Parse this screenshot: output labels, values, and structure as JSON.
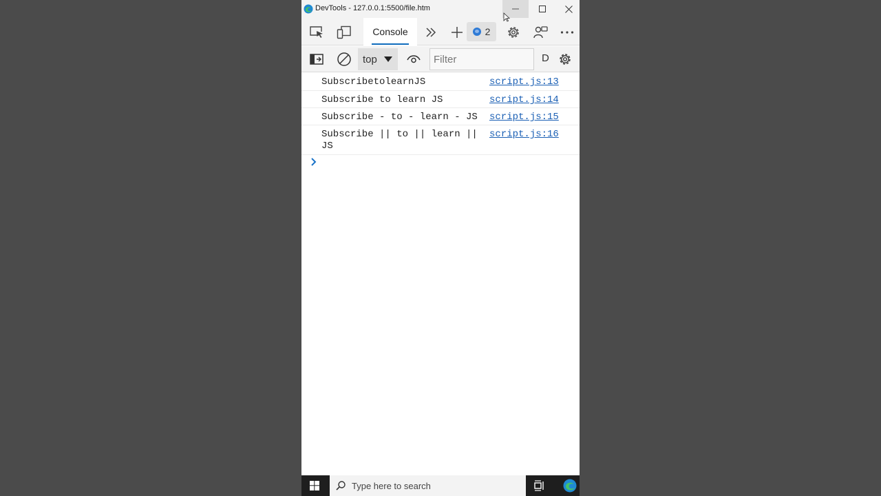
{
  "window": {
    "title": "DevTools - 127.0.0.1:5500/file.htm"
  },
  "tabs": {
    "console_label": "Console",
    "issues_count": "2"
  },
  "toolbar": {
    "context": "top",
    "filter_placeholder": "Filter",
    "levels_label": "D"
  },
  "messages": [
    {
      "text": "SubscribetolearnJS",
      "source": "script.js:13"
    },
    {
      "text": "Subscribe to learn JS",
      "source": "script.js:14"
    },
    {
      "text": "Subscribe - to - learn - JS",
      "source": "script.js:15"
    },
    {
      "text": "Subscribe || to || learn || JS",
      "source": "script.js:16"
    }
  ],
  "taskbar": {
    "search_placeholder": "Type here to search"
  },
  "colors": {
    "accent": "#0f6cbd",
    "link": "#1a5fb4",
    "desktop": "#4b4b4b"
  }
}
